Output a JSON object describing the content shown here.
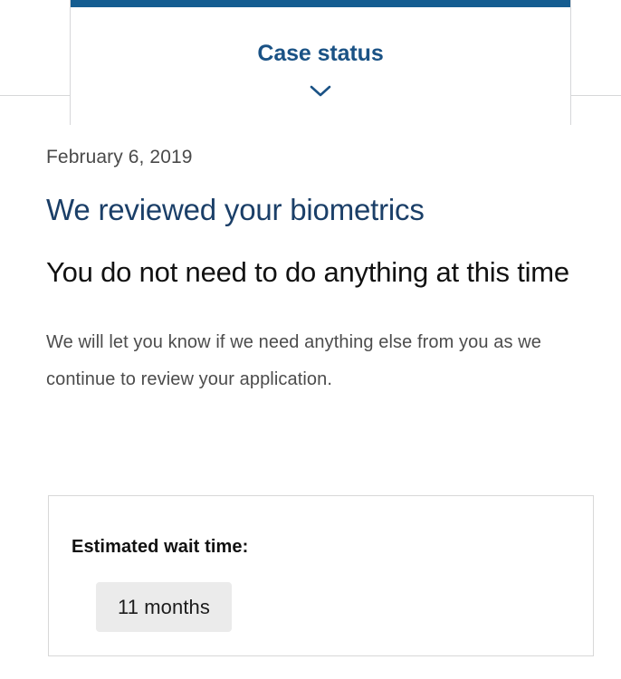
{
  "tab": {
    "title": "Case status",
    "accent_color": "#155d91",
    "title_color": "#1a5285",
    "chevron_icon": "chevron-down-icon",
    "expanded": true
  },
  "status_update": {
    "date": "February 6, 2019",
    "heading": "We reviewed your biometrics",
    "heading_color": "#1b3f68",
    "subheading": "You do not need to do anything at this time",
    "body": "We will let you know if we need anything else from you as we continue to review your application."
  },
  "wait_time": {
    "label": "Estimated wait time:",
    "value": "11 months",
    "chip_background": "#ebebeb",
    "panel_border_color": "#d8d8d8"
  }
}
